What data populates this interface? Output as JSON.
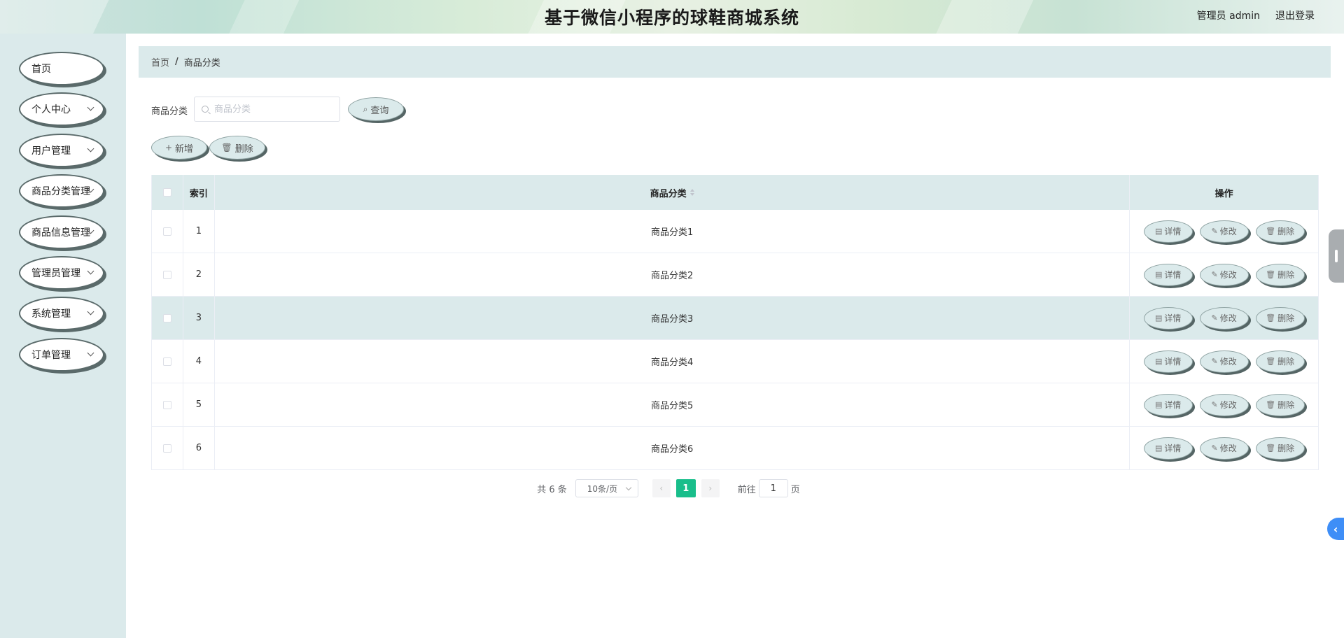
{
  "header": {
    "title": "基于微信小程序的球鞋商城系统",
    "user": "管理员 admin",
    "logout": "退出登录"
  },
  "sidebar": {
    "items": [
      {
        "label": "首页",
        "has_arrow": false
      },
      {
        "label": "个人中心",
        "has_arrow": true
      },
      {
        "label": "用户管理",
        "has_arrow": true
      },
      {
        "label": "商品分类管理",
        "has_arrow": true
      },
      {
        "label": "商品信息管理",
        "has_arrow": true
      },
      {
        "label": "管理员管理",
        "has_arrow": true
      },
      {
        "label": "系统管理",
        "has_arrow": true
      },
      {
        "label": "订单管理",
        "has_arrow": true
      }
    ]
  },
  "breadcrumb": {
    "home": "首页",
    "separator": "/",
    "current": "商品分类"
  },
  "search": {
    "label": "商品分类",
    "placeholder": "商品分类",
    "value": "",
    "button": "查询"
  },
  "actions": {
    "add": "新增",
    "delete": "删除"
  },
  "table": {
    "columns": {
      "index": "索引",
      "category": "商品分类",
      "operation": "操作"
    },
    "rows": [
      {
        "index": "1",
        "category": "商品分类1",
        "highlighted": false
      },
      {
        "index": "2",
        "category": "商品分类2",
        "highlighted": false
      },
      {
        "index": "3",
        "category": "商品分类3",
        "highlighted": true
      },
      {
        "index": "4",
        "category": "商品分类4",
        "highlighted": false
      },
      {
        "index": "5",
        "category": "商品分类5",
        "highlighted": false
      },
      {
        "index": "6",
        "category": "商品分类6",
        "highlighted": false
      }
    ],
    "row_actions": {
      "detail": "详情",
      "edit": "修改",
      "delete": "删除"
    }
  },
  "pagination": {
    "total": "共 6 条",
    "page_size": "10条/页",
    "current_page": "1",
    "goto_label": "前往",
    "goto_value": "1",
    "page_suffix": "页"
  },
  "colors": {
    "accent": "#19be8b",
    "panel": "#dbeaeb",
    "float_button": "#3e8ef7"
  }
}
